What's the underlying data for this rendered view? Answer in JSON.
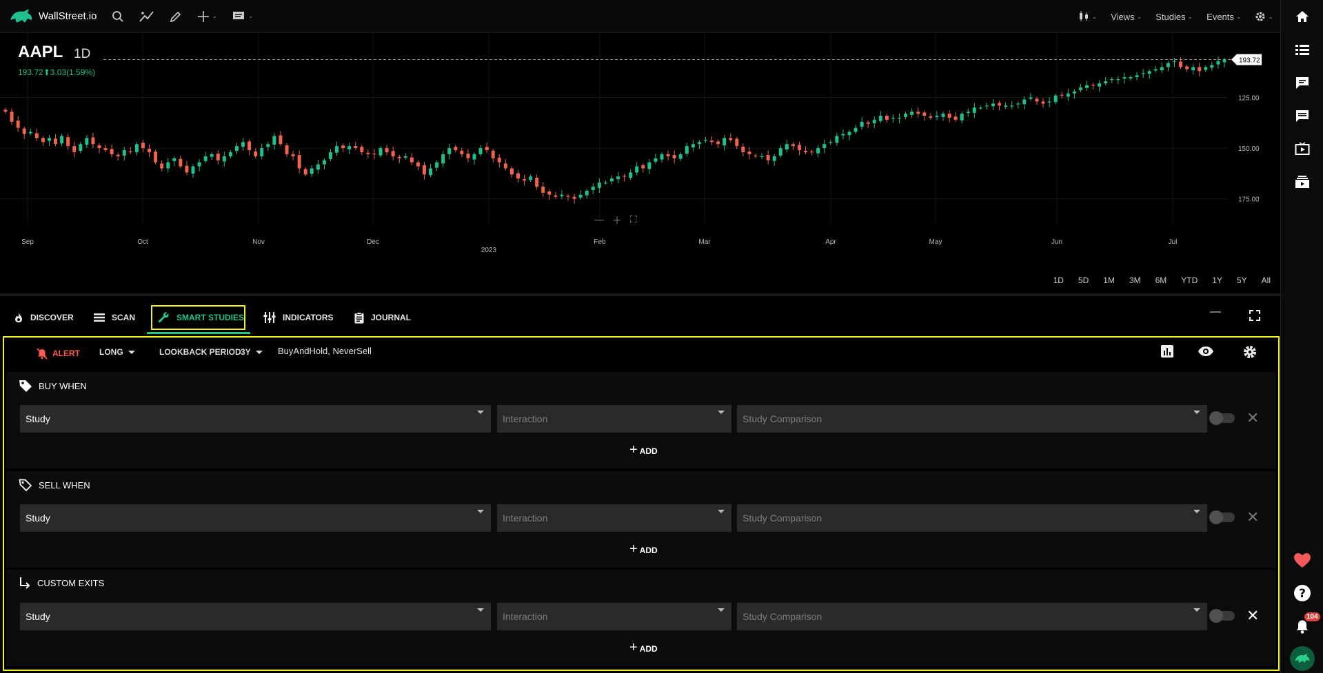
{
  "app": {
    "name": "WallStreet.io"
  },
  "toolbar": {
    "views": "Views",
    "studies": "Studies",
    "events": "Events"
  },
  "chart": {
    "symbol": "AAPL",
    "timeframe": "1D",
    "price": "193.72",
    "change": "3.03(1.59%)",
    "last_label": "193.72",
    "price_ticks": [
      "175.00",
      "150.00",
      "125.00"
    ],
    "months": [
      "Sep",
      "Oct",
      "Nov",
      "Dec",
      "Feb",
      "Mar",
      "Apr",
      "May",
      "Jun",
      "Jul"
    ],
    "year": "2023",
    "up_color": "#1fbf8f",
    "down_color": "#f0644d"
  },
  "chart_data": {
    "type": "candlestick",
    "ylim": [
      115,
      200
    ],
    "last_price": 193.72,
    "price_ticks": [
      125,
      150,
      175
    ],
    "closes": [
      168,
      163,
      160,
      157,
      158,
      155,
      153,
      155,
      152,
      156,
      151,
      148,
      152,
      155,
      152,
      150,
      149,
      147,
      146,
      149,
      148,
      152,
      150,
      148,
      143,
      140,
      143,
      145,
      141,
      138,
      141,
      143,
      146,
      147,
      144,
      146,
      148,
      151,
      153,
      149,
      146,
      150,
      152,
      156,
      152,
      147,
      146,
      140,
      137,
      140,
      142,
      144,
      148,
      151,
      150,
      151,
      150,
      148,
      147,
      147,
      150,
      148,
      146,
      145,
      146,
      143,
      141,
      137,
      140,
      143,
      147,
      150,
      149,
      147,
      145,
      147,
      150,
      149,
      145,
      143,
      140,
      137,
      135,
      134,
      136,
      131,
      128,
      127,
      126,
      127,
      126,
      125,
      127,
      129,
      131,
      133,
      133,
      135,
      136,
      136,
      138,
      141,
      140,
      143,
      145,
      147,
      146,
      145,
      147,
      151,
      152,
      153,
      154,
      153,
      152,
      155,
      154,
      151,
      148,
      147,
      146,
      146,
      144,
      146,
      150,
      152,
      151,
      149,
      148,
      148,
      150,
      152,
      153,
      156,
      157,
      158,
      160,
      163,
      162,
      164,
      166,
      164,
      165,
      165,
      167,
      168,
      167,
      166,
      165,
      166,
      167,
      165,
      164,
      167,
      168,
      170,
      170,
      171,
      172,
      171,
      171,
      171,
      172,
      174,
      175,
      173,
      172,
      173,
      176,
      176,
      177,
      178,
      180,
      181,
      181,
      182,
      183,
      184,
      184,
      185,
      185,
      186,
      187,
      188,
      189,
      190,
      192,
      193,
      190,
      189,
      190,
      188,
      190,
      191,
      193,
      193.72
    ]
  },
  "ranges": [
    "1D",
    "5D",
    "1M",
    "3M",
    "6M",
    "YTD",
    "1Y",
    "5Y",
    "All"
  ],
  "tabs": [
    {
      "label": "DISCOVER"
    },
    {
      "label": "SCAN"
    },
    {
      "label": "SMART STUDIES"
    },
    {
      "label": "INDICATORS"
    },
    {
      "label": "JOURNAL"
    }
  ],
  "panel": {
    "alert": "ALERT",
    "direction": "LONG",
    "lookback_label": "LOOKBACK PERIOD",
    "lookback_value": "3Y",
    "strategy": "BuyAndHold, NeverSell",
    "sections": [
      {
        "title": "BUY WHEN",
        "study": "Study",
        "interaction": "Interaction",
        "comparison": "Study Comparison",
        "add": "ADD"
      },
      {
        "title": "SELL WHEN",
        "study": "Study",
        "interaction": "Interaction",
        "comparison": "Study Comparison",
        "add": "ADD"
      },
      {
        "title": "CUSTOM EXITS",
        "study": "Study",
        "interaction": "Interaction",
        "comparison": "Study Comparison",
        "add": "ADD"
      }
    ]
  },
  "rail": {
    "notifications": "104"
  }
}
